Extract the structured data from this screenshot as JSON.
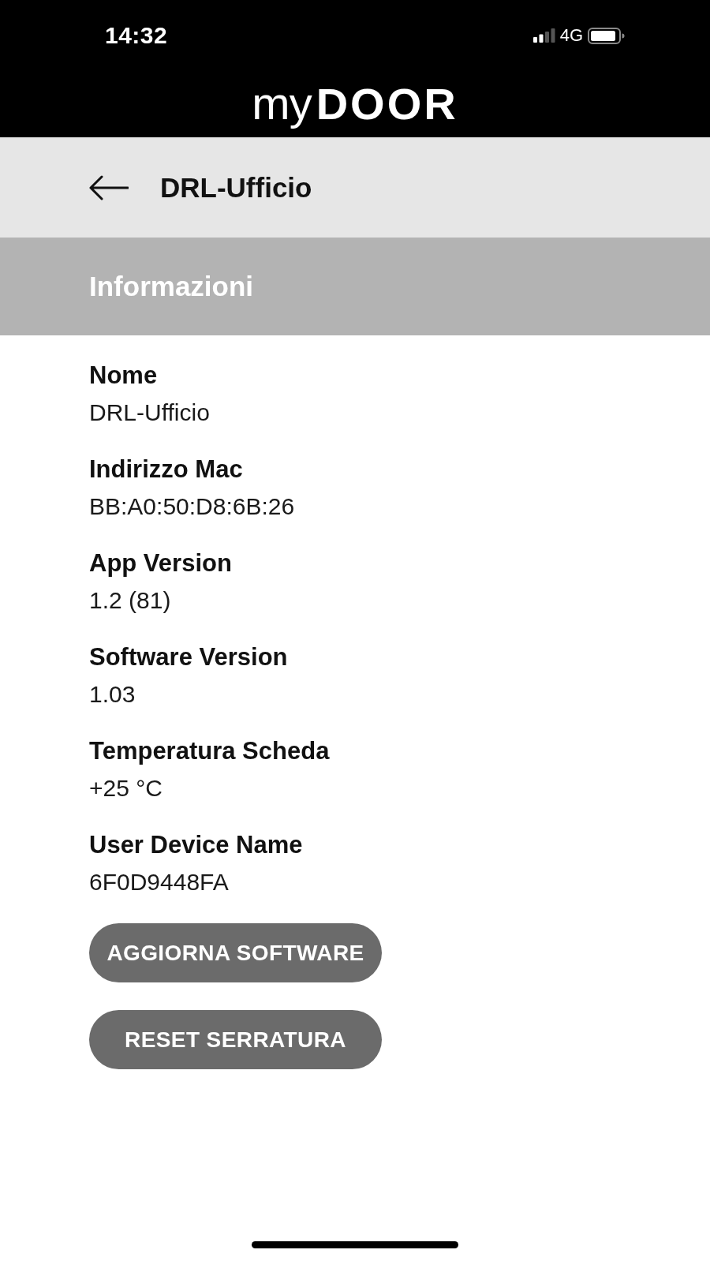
{
  "status_bar": {
    "time": "14:32",
    "network": "4G"
  },
  "app_bar": {
    "logo": {
      "light": "my",
      "bold": "DOOR"
    }
  },
  "header": {
    "title": "DRL-Ufficio"
  },
  "section": {
    "title": "Informazioni"
  },
  "fields": [
    {
      "label": "Nome",
      "value": "DRL-Ufficio"
    },
    {
      "label": "Indirizzo Mac",
      "value": "BB:A0:50:D8:6B:26"
    },
    {
      "label": "App Version",
      "value": "1.2 (81)"
    },
    {
      "label": "Software Version",
      "value": "1.03"
    },
    {
      "label": "Temperatura Scheda",
      "value": "+25 °C"
    },
    {
      "label": "User Device Name",
      "value": "6F0D9448FA"
    }
  ],
  "buttons": [
    "AGGIORNA SOFTWARE",
    "RESET SERRATURA"
  ]
}
